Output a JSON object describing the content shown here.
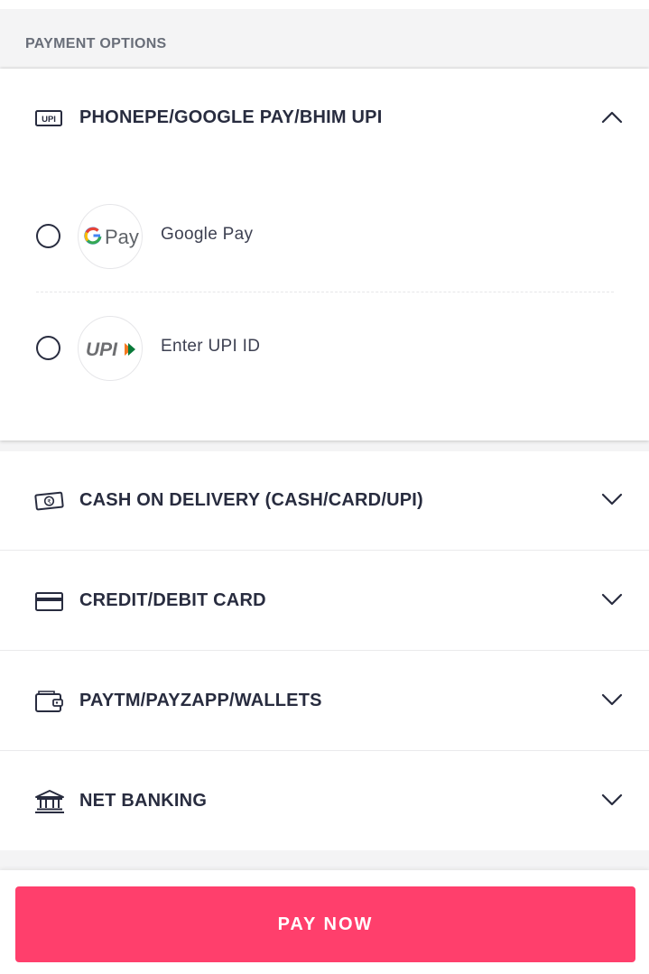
{
  "section_title": "PAYMENT OPTIONS",
  "upi_section": {
    "label": "PHONEPE/GOOGLE PAY/BHIM UPI",
    "icon": "upi-icon",
    "icon_text": "UPI",
    "expanded": true,
    "options": [
      {
        "label": "Google Pay",
        "logo": "google-pay-logo",
        "logo_text": "Pay",
        "selected": false
      },
      {
        "label": "Enter UPI ID",
        "logo": "upi-logo",
        "logo_text": "UPI",
        "selected": false
      }
    ]
  },
  "methods": [
    {
      "label": "CASH ON DELIVERY (CASH/CARD/UPI)",
      "icon": "cash-icon",
      "icon_text": "₹"
    },
    {
      "label": "CREDIT/DEBIT CARD",
      "icon": "card-icon"
    },
    {
      "label": "PAYTM/PAYZAPP/WALLETS",
      "icon": "wallet-icon"
    },
    {
      "label": "NET BANKING",
      "icon": "bank-icon"
    }
  ],
  "footer": {
    "pay_button": "PAY NOW"
  },
  "colors": {
    "accent": "#ff3f6c",
    "text": "#282c3f",
    "muted": "#696e79",
    "background": "#f4f4f5"
  }
}
